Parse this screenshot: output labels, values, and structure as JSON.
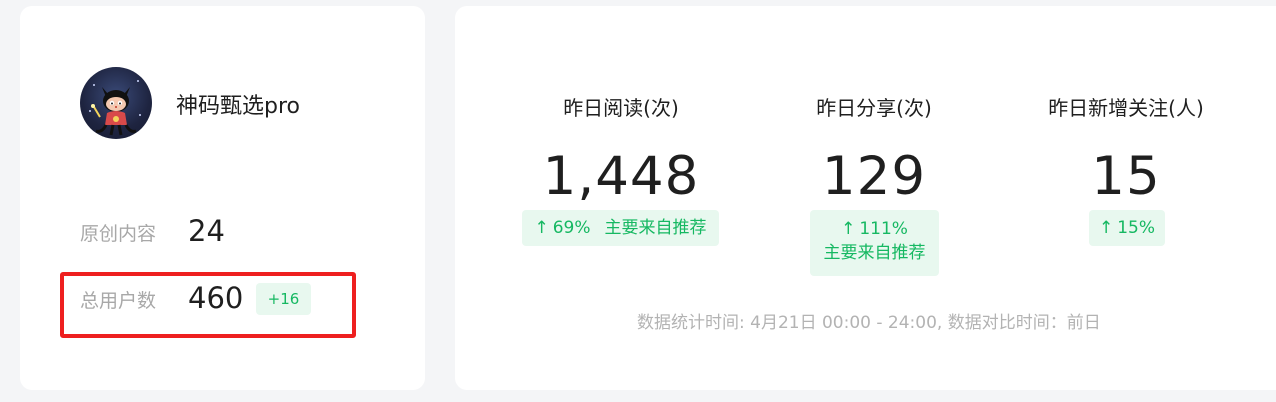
{
  "account": {
    "name": "神码甄选pro",
    "avatar_icon": "github-octocat-avatar"
  },
  "stats": {
    "original": {
      "label": "原创内容",
      "value": "24"
    },
    "users": {
      "label": "总用户数",
      "value": "460",
      "delta": "+16"
    }
  },
  "metrics": [
    {
      "title": "昨日阅读(次)",
      "value": "1,448",
      "arrow": "↑",
      "change": "69%",
      "source": "主要来自推荐"
    },
    {
      "title": "昨日分享(次)",
      "value": "129",
      "arrow": "↑",
      "change": "111%",
      "source": "主要来自推荐"
    },
    {
      "title": "昨日新增关注(人)",
      "value": "15",
      "arrow": "↑",
      "change": "15%"
    }
  ],
  "footnote": "数据统计时间: 4月21日 00:00 - 24:00, 数据对比时间：前日",
  "colors": {
    "accent_green": "#16b862",
    "badge_bg": "#e8f8ef",
    "highlight_red": "#ee1f1f"
  }
}
